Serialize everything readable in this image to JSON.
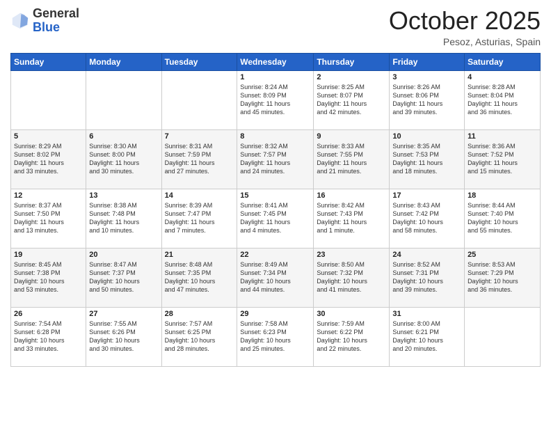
{
  "header": {
    "logo_general": "General",
    "logo_blue": "Blue",
    "month_title": "October 2025",
    "location": "Pesoz, Asturias, Spain"
  },
  "days_of_week": [
    "Sunday",
    "Monday",
    "Tuesday",
    "Wednesday",
    "Thursday",
    "Friday",
    "Saturday"
  ],
  "weeks": [
    [
      {
        "day": "",
        "info": ""
      },
      {
        "day": "",
        "info": ""
      },
      {
        "day": "",
        "info": ""
      },
      {
        "day": "1",
        "info": "Sunrise: 8:24 AM\nSunset: 8:09 PM\nDaylight: 11 hours\nand 45 minutes."
      },
      {
        "day": "2",
        "info": "Sunrise: 8:25 AM\nSunset: 8:07 PM\nDaylight: 11 hours\nand 42 minutes."
      },
      {
        "day": "3",
        "info": "Sunrise: 8:26 AM\nSunset: 8:06 PM\nDaylight: 11 hours\nand 39 minutes."
      },
      {
        "day": "4",
        "info": "Sunrise: 8:28 AM\nSunset: 8:04 PM\nDaylight: 11 hours\nand 36 minutes."
      }
    ],
    [
      {
        "day": "5",
        "info": "Sunrise: 8:29 AM\nSunset: 8:02 PM\nDaylight: 11 hours\nand 33 minutes."
      },
      {
        "day": "6",
        "info": "Sunrise: 8:30 AM\nSunset: 8:00 PM\nDaylight: 11 hours\nand 30 minutes."
      },
      {
        "day": "7",
        "info": "Sunrise: 8:31 AM\nSunset: 7:59 PM\nDaylight: 11 hours\nand 27 minutes."
      },
      {
        "day": "8",
        "info": "Sunrise: 8:32 AM\nSunset: 7:57 PM\nDaylight: 11 hours\nand 24 minutes."
      },
      {
        "day": "9",
        "info": "Sunrise: 8:33 AM\nSunset: 7:55 PM\nDaylight: 11 hours\nand 21 minutes."
      },
      {
        "day": "10",
        "info": "Sunrise: 8:35 AM\nSunset: 7:53 PM\nDaylight: 11 hours\nand 18 minutes."
      },
      {
        "day": "11",
        "info": "Sunrise: 8:36 AM\nSunset: 7:52 PM\nDaylight: 11 hours\nand 15 minutes."
      }
    ],
    [
      {
        "day": "12",
        "info": "Sunrise: 8:37 AM\nSunset: 7:50 PM\nDaylight: 11 hours\nand 13 minutes."
      },
      {
        "day": "13",
        "info": "Sunrise: 8:38 AM\nSunset: 7:48 PM\nDaylight: 11 hours\nand 10 minutes."
      },
      {
        "day": "14",
        "info": "Sunrise: 8:39 AM\nSunset: 7:47 PM\nDaylight: 11 hours\nand 7 minutes."
      },
      {
        "day": "15",
        "info": "Sunrise: 8:41 AM\nSunset: 7:45 PM\nDaylight: 11 hours\nand 4 minutes."
      },
      {
        "day": "16",
        "info": "Sunrise: 8:42 AM\nSunset: 7:43 PM\nDaylight: 11 hours\nand 1 minute."
      },
      {
        "day": "17",
        "info": "Sunrise: 8:43 AM\nSunset: 7:42 PM\nDaylight: 10 hours\nand 58 minutes."
      },
      {
        "day": "18",
        "info": "Sunrise: 8:44 AM\nSunset: 7:40 PM\nDaylight: 10 hours\nand 55 minutes."
      }
    ],
    [
      {
        "day": "19",
        "info": "Sunrise: 8:45 AM\nSunset: 7:38 PM\nDaylight: 10 hours\nand 53 minutes."
      },
      {
        "day": "20",
        "info": "Sunrise: 8:47 AM\nSunset: 7:37 PM\nDaylight: 10 hours\nand 50 minutes."
      },
      {
        "day": "21",
        "info": "Sunrise: 8:48 AM\nSunset: 7:35 PM\nDaylight: 10 hours\nand 47 minutes."
      },
      {
        "day": "22",
        "info": "Sunrise: 8:49 AM\nSunset: 7:34 PM\nDaylight: 10 hours\nand 44 minutes."
      },
      {
        "day": "23",
        "info": "Sunrise: 8:50 AM\nSunset: 7:32 PM\nDaylight: 10 hours\nand 41 minutes."
      },
      {
        "day": "24",
        "info": "Sunrise: 8:52 AM\nSunset: 7:31 PM\nDaylight: 10 hours\nand 39 minutes."
      },
      {
        "day": "25",
        "info": "Sunrise: 8:53 AM\nSunset: 7:29 PM\nDaylight: 10 hours\nand 36 minutes."
      }
    ],
    [
      {
        "day": "26",
        "info": "Sunrise: 7:54 AM\nSunset: 6:28 PM\nDaylight: 10 hours\nand 33 minutes."
      },
      {
        "day": "27",
        "info": "Sunrise: 7:55 AM\nSunset: 6:26 PM\nDaylight: 10 hours\nand 30 minutes."
      },
      {
        "day": "28",
        "info": "Sunrise: 7:57 AM\nSunset: 6:25 PM\nDaylight: 10 hours\nand 28 minutes."
      },
      {
        "day": "29",
        "info": "Sunrise: 7:58 AM\nSunset: 6:23 PM\nDaylight: 10 hours\nand 25 minutes."
      },
      {
        "day": "30",
        "info": "Sunrise: 7:59 AM\nSunset: 6:22 PM\nDaylight: 10 hours\nand 22 minutes."
      },
      {
        "day": "31",
        "info": "Sunrise: 8:00 AM\nSunset: 6:21 PM\nDaylight: 10 hours\nand 20 minutes."
      },
      {
        "day": "",
        "info": ""
      }
    ]
  ]
}
